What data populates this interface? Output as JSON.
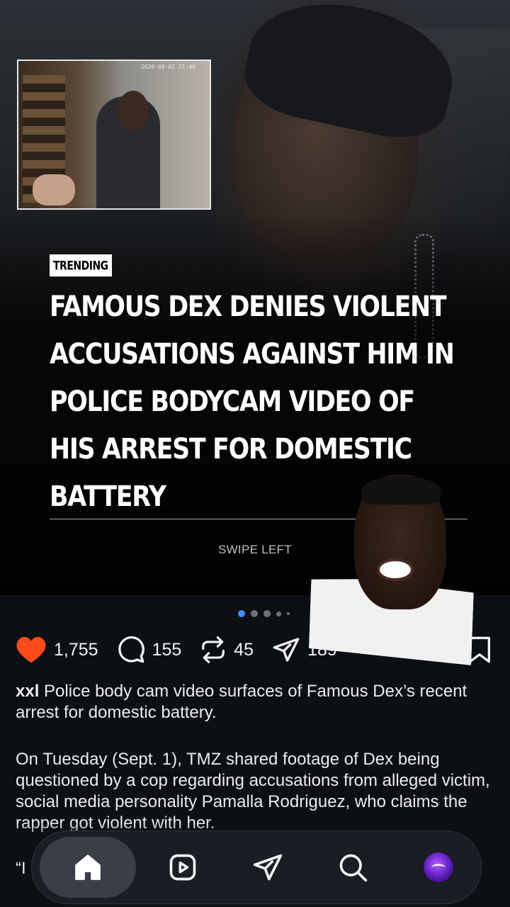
{
  "post": {
    "badge": "TRENDING",
    "headline_lines": [
      "FAMOUS DEX DENIES VIOLENT",
      "ACCUSATIONS AGAINST HIM IN",
      "POLICE BODYCAM VIDEO OF",
      "HIS ARREST FOR DOMESTIC",
      "BATTERY"
    ],
    "swipe_hint": "SWIPE LEFT",
    "bodycam_stamp": "2020-09-01 21:40"
  },
  "actions": {
    "likes": "1,755",
    "comments": "155",
    "reposts": "45",
    "shares": "189"
  },
  "caption": {
    "username": "xxl",
    "text": " Police body cam video surfaces of Famous Dex’s recent arrest for domestic battery.",
    "paragraph2": "On Tuesday (Sept. 1), TMZ shared footage of Dex being questioned by a cop regarding accusations from alleged victim, social media personality Pamalla Rodriguez, who claims the rapper got violent with her.",
    "peek": "“I"
  },
  "carousel": {
    "count": 5,
    "active": 1
  },
  "colors": {
    "like": "#ff4a1c",
    "accent_dot": "#3d8bff",
    "background": "#0c0f14"
  },
  "nav": [
    "home-icon",
    "reels-icon",
    "send-icon",
    "search-icon",
    "profile-avatar"
  ]
}
